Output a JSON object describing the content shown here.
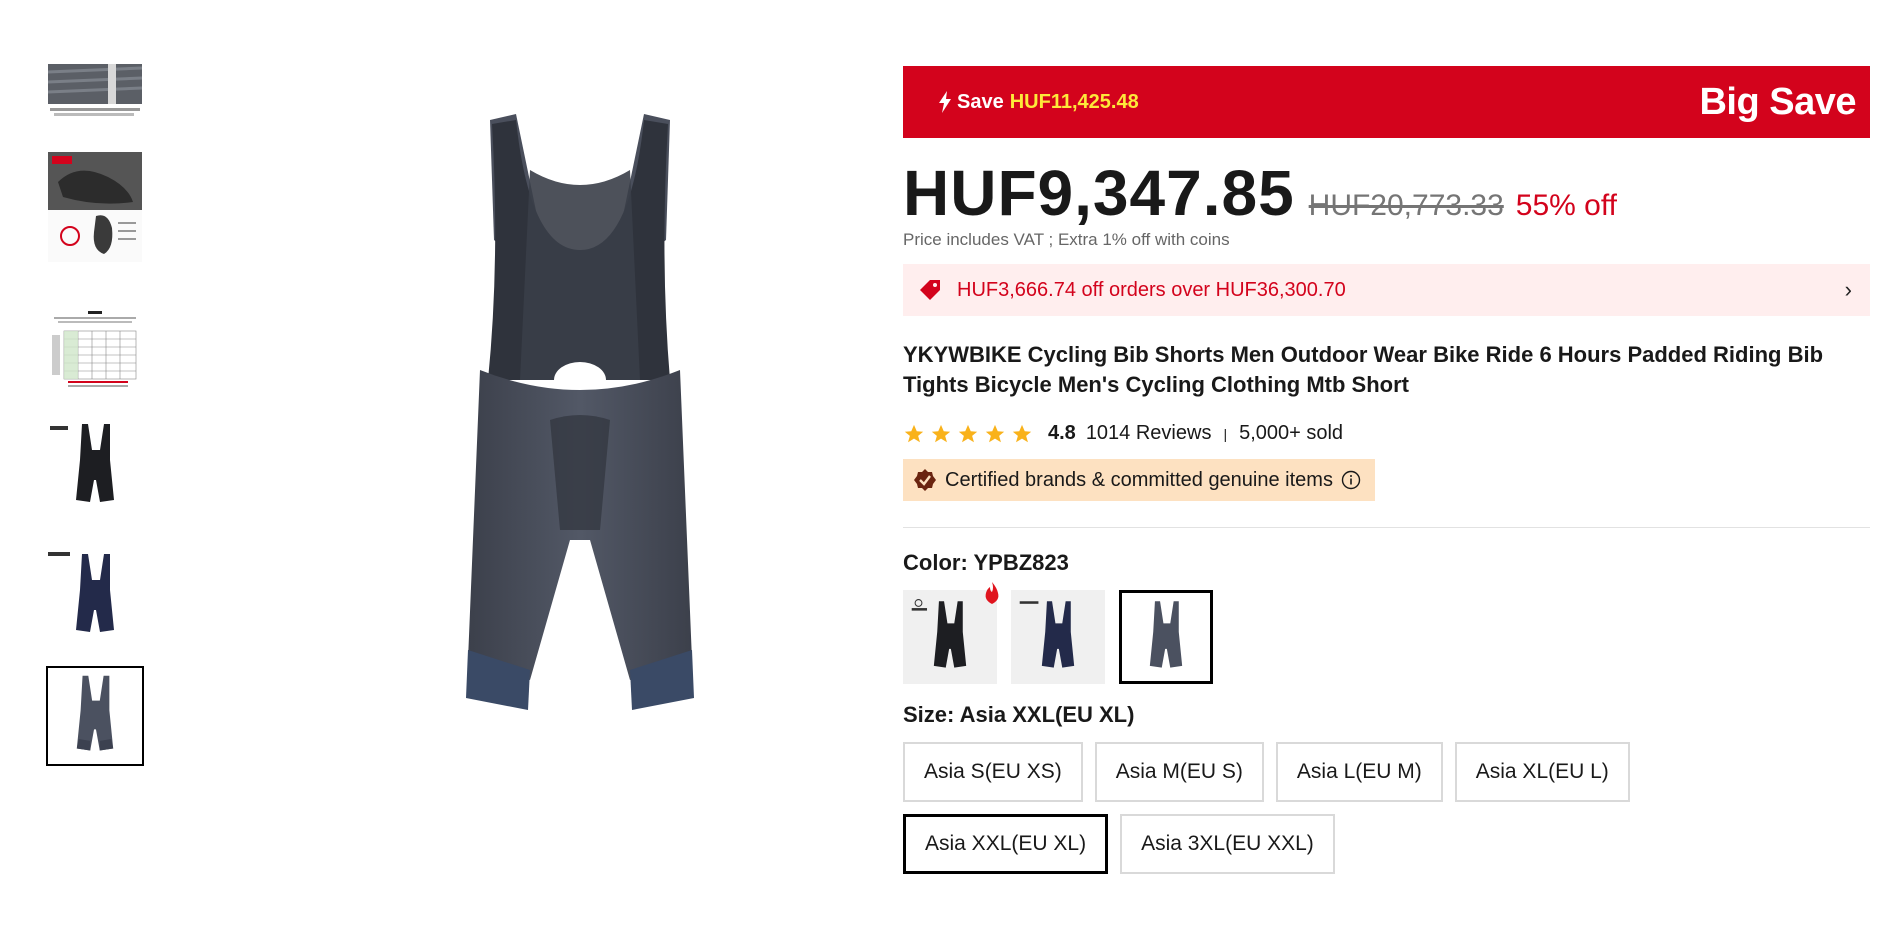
{
  "colors": {
    "accent": "#d3031c",
    "banner_amount": "#fde93a",
    "star": "#f9b21b",
    "certified_bg": "#fde1c1"
  },
  "thumbnails": [
    {
      "icon": "detail-fabric-image",
      "active": false
    },
    {
      "icon": "chamois-pad-image",
      "active": false
    },
    {
      "icon": "size-chart-image",
      "active": false
    },
    {
      "icon": "black-bib-image",
      "active": false
    },
    {
      "icon": "navy-bib-image",
      "active": false
    },
    {
      "icon": "grey-bib-image",
      "active": true
    }
  ],
  "banner": {
    "save_label": "Save",
    "save_amount": "HUF11,425.48",
    "promo_label": "Big Save"
  },
  "price": {
    "current": "HUF9,347.85",
    "original": "HUF20,773.33",
    "discount": "55% off",
    "note": "Price includes VAT ; Extra 1% off with coins"
  },
  "coupon": {
    "text": "HUF3,666.74 off orders over HUF36,300.70"
  },
  "product": {
    "title": "YKYWBIKE Cycling Bib Shorts Men Outdoor Wear Bike Ride 6 Hours Padded Riding Bib Tights Bicycle Men's Cycling Clothing Mtb Short",
    "rating": "4.8",
    "stars": 5,
    "reviews": "1014 Reviews",
    "sold": "5,000+ sold",
    "certified": "Certified brands & committed genuine items"
  },
  "color": {
    "label": "Color: YPBZ823",
    "options": [
      "black",
      "navy",
      "grey"
    ],
    "selected": "grey"
  },
  "size": {
    "label": "Size: Asia XXL(EU XL)",
    "options": [
      "Asia S(EU XS)",
      "Asia M(EU S)",
      "Asia L(EU M)",
      "Asia XL(EU L)",
      "Asia XXL(EU XL)",
      "Asia 3XL(EU XXL)"
    ],
    "selected": "Asia XXL(EU XL)"
  }
}
